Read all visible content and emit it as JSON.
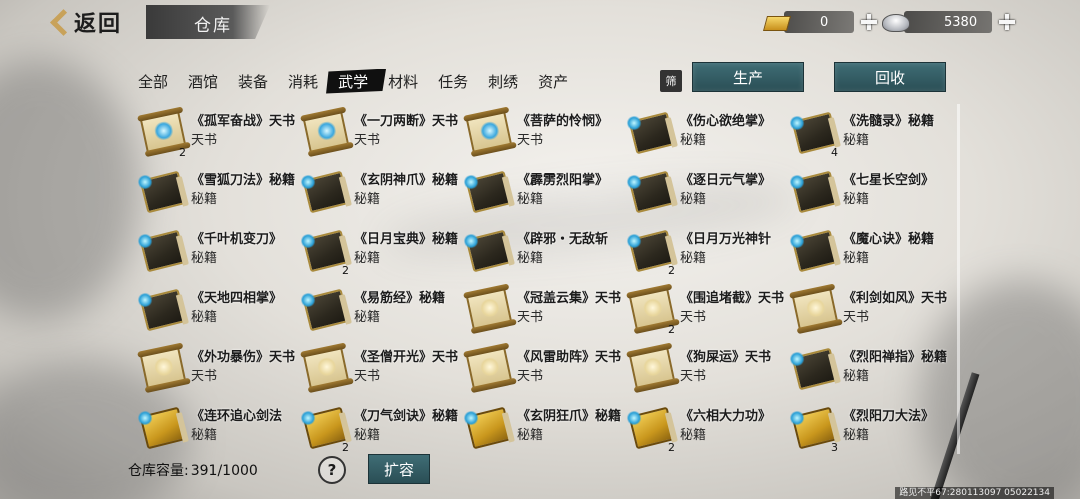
{
  "header": {
    "back_label": "返回",
    "title": "仓库"
  },
  "currency": {
    "gold": "0",
    "silver": "5380"
  },
  "tabs": [
    {
      "label": "全部",
      "active": false
    },
    {
      "label": "酒馆",
      "active": false
    },
    {
      "label": "装备",
      "active": false
    },
    {
      "label": "消耗",
      "active": false
    },
    {
      "label": "武学",
      "active": true
    },
    {
      "label": "材料",
      "active": false
    },
    {
      "label": "任务",
      "active": false
    },
    {
      "label": "刺绣",
      "active": false
    },
    {
      "label": "资产",
      "active": false
    }
  ],
  "filter_label": "筛",
  "buttons": {
    "produce": "生产",
    "recycle": "回收",
    "expand": "扩容"
  },
  "items": [
    {
      "name": "《孤军奋战》天书",
      "type": "天书",
      "icon": "scroll-icon",
      "count": "2"
    },
    {
      "name": "《一刀两断》天书",
      "type": "天书",
      "icon": "scroll-icon",
      "count": ""
    },
    {
      "name": "《菩萨的怜悯》",
      "type": "天书",
      "icon": "scroll-icon",
      "count": ""
    },
    {
      "name": "《伤心欲绝掌》",
      "type": "秘籍",
      "icon": "book-icon",
      "count": ""
    },
    {
      "name": "《洗髓录》秘籍",
      "type": "秘籍",
      "icon": "book-icon",
      "count": "4"
    },
    {
      "name": "《雪狐刀法》秘籍",
      "type": "秘籍",
      "icon": "book-icon",
      "count": ""
    },
    {
      "name": "《玄阴神爪》秘籍",
      "type": "秘籍",
      "icon": "book-icon",
      "count": ""
    },
    {
      "name": "《霹雳烈阳掌》",
      "type": "秘籍",
      "icon": "book-icon",
      "count": ""
    },
    {
      "name": "《逐日元气掌》",
      "type": "秘籍",
      "icon": "book-icon",
      "count": ""
    },
    {
      "name": "《七星长空剑》",
      "type": "秘籍",
      "icon": "book-icon",
      "count": ""
    },
    {
      "name": "《千叶机变刀》",
      "type": "秘籍",
      "icon": "book-icon",
      "count": ""
    },
    {
      "name": "《日月宝典》秘籍",
      "type": "秘籍",
      "icon": "book-icon",
      "count": "2"
    },
    {
      "name": "《辟邪・无敌斩",
      "type": "秘籍",
      "icon": "book-icon",
      "count": ""
    },
    {
      "name": "《日月万光神针",
      "type": "秘籍",
      "icon": "book-icon",
      "count": "2"
    },
    {
      "name": "《魔心诀》秘籍",
      "type": "秘籍",
      "icon": "book-icon",
      "count": ""
    },
    {
      "name": "《天地四相掌》",
      "type": "秘籍",
      "icon": "book-icon",
      "count": ""
    },
    {
      "name": "《易筋经》秘籍",
      "type": "秘籍",
      "icon": "book-icon",
      "count": ""
    },
    {
      "name": "《冠盖云集》天书",
      "type": "天书",
      "icon": "scroll-icon",
      "count": ""
    },
    {
      "name": "《围追堵截》天书",
      "type": "天书",
      "icon": "scroll-icon",
      "count": "2"
    },
    {
      "name": "《利剑如风》天书",
      "type": "天书",
      "icon": "scroll-icon",
      "count": ""
    },
    {
      "name": "《外功暴伤》天书",
      "type": "天书",
      "icon": "scroll-icon",
      "count": ""
    },
    {
      "name": "《圣僧开光》天书",
      "type": "天书",
      "icon": "scroll-icon",
      "count": ""
    },
    {
      "name": "《风雷助阵》天书",
      "type": "天书",
      "icon": "scroll-icon",
      "count": ""
    },
    {
      "name": "《狗屎运》天书",
      "type": "天书",
      "icon": "scroll-icon",
      "count": ""
    },
    {
      "name": "《烈阳禅指》秘籍",
      "type": "秘籍",
      "icon": "book-icon",
      "count": ""
    },
    {
      "name": "《连环追心剑法",
      "type": "秘籍",
      "icon": "book-icon",
      "count": ""
    },
    {
      "name": "《刀气剑诀》秘籍",
      "type": "秘籍",
      "icon": "book-icon",
      "count": "2"
    },
    {
      "name": "《玄阴狂爪》秘籍",
      "type": "秘籍",
      "icon": "book-icon",
      "count": ""
    },
    {
      "name": "《六相大力功》",
      "type": "秘籍",
      "icon": "book-icon",
      "count": "2"
    },
    {
      "name": "《烈阳刀大法》",
      "type": "秘籍",
      "icon": "book-icon",
      "count": "3"
    }
  ],
  "footer": {
    "capacity_label": "仓库容量:",
    "capacity_value": "391/1000",
    "help_symbol": "?"
  },
  "version": "路见不平67:280113097 05022134"
}
